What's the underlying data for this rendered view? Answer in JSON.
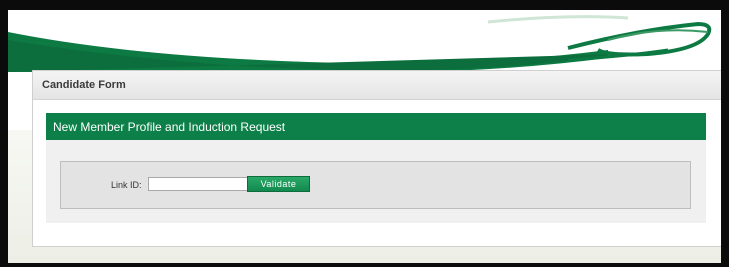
{
  "panel": {
    "title": "Candidate Form"
  },
  "form": {
    "heading": "New Member Profile and Induction Request",
    "link_id_label": "Link ID:",
    "link_id_value": "",
    "validate_label": "Validate"
  },
  "colors": {
    "brand_green": "#0d8049",
    "button_green": "#1a9a5a",
    "frame": "#0b0b0b"
  }
}
